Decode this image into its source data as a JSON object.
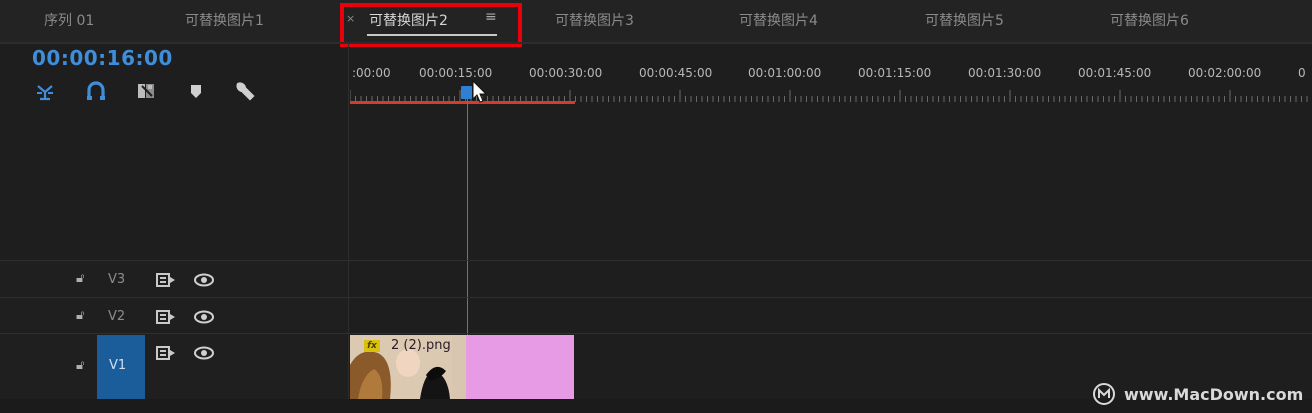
{
  "tabs": [
    {
      "label": "序列 01",
      "active": false
    },
    {
      "label": "可替换图片1",
      "active": false
    },
    {
      "label": "可替换图片2",
      "active": true
    },
    {
      "label": "可替换图片3",
      "active": false
    },
    {
      "label": "可替换图片4",
      "active": false
    },
    {
      "label": "可替换图片5",
      "active": false
    },
    {
      "label": "可替换图片6",
      "active": false
    }
  ],
  "active_tab_menu_icon": "hamburger-icon",
  "active_tab_close_icon": "close-icon",
  "highlight_color": "#e8000b",
  "timecode": "00:00:16:00",
  "timecode_color": "#3f8edb",
  "tools": [
    "snap-in-sequence-icon",
    "linked-selection-icon",
    "add-marker-icon",
    "marker-icon",
    "wrench-icon"
  ],
  "ruler": {
    "labels": [
      ":00:00",
      "00:00:15:00",
      "00:00:30:00",
      "00:00:45:00",
      "00:01:00:00",
      "00:01:15:00",
      "00:01:30:00",
      "00:01:45:00",
      "00:02:00:00"
    ],
    "playhead_seconds": 16
  },
  "tracks": [
    {
      "name": "V3",
      "lock_icon": "lock-icon",
      "sync_icon": "sync-lock-icon",
      "eye_icon": "eye-icon"
    },
    {
      "name": "V2",
      "lock_icon": "lock-icon",
      "sync_icon": "sync-lock-icon",
      "eye_icon": "eye-icon"
    },
    {
      "name": "V1",
      "lock_icon": "lock-icon",
      "sync_icon": "sync-lock-icon",
      "eye_icon": "eye-icon",
      "targeted": true
    }
  ],
  "clip": {
    "name": "2 (2).png",
    "fx_badge": "fx",
    "color": "#e69be4"
  },
  "watermark": {
    "text": "www.MacDown.com"
  }
}
